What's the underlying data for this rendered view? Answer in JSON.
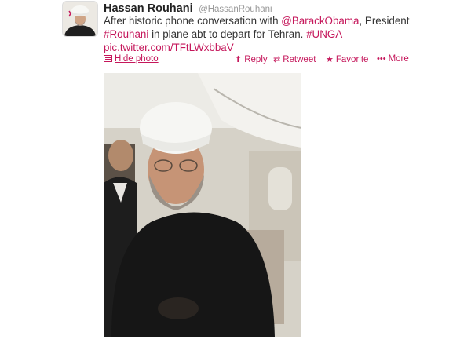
{
  "tweet": {
    "author": {
      "name": "Hassan Rouhani",
      "handle": "@HassanRouhani"
    },
    "text": {
      "part1": "After historic phone conversation with ",
      "mention": "@BarackObama",
      "part2": ", President ",
      "hashtag1": "#Rouhani",
      "part3": " in plane abt to depart for Tehran. ",
      "hashtag2": "#UNGA",
      "media_link": "pic.twitter.com/TFtLWxbbaV"
    }
  },
  "actions": {
    "hide_photo": "Hide photo",
    "reply": "Reply",
    "retweet": "Retweet",
    "favorite": "Favorite",
    "more": "More"
  },
  "colors": {
    "link": "#c5175b",
    "text": "#333333",
    "muted": "#999999"
  },
  "icons": {
    "avatar": "profile-photo",
    "hide_photo": "photo-icon",
    "reply": "reply-arrow-icon",
    "retweet": "retweet-icon",
    "favorite": "star-icon",
    "more": "ellipsis-icon"
  }
}
